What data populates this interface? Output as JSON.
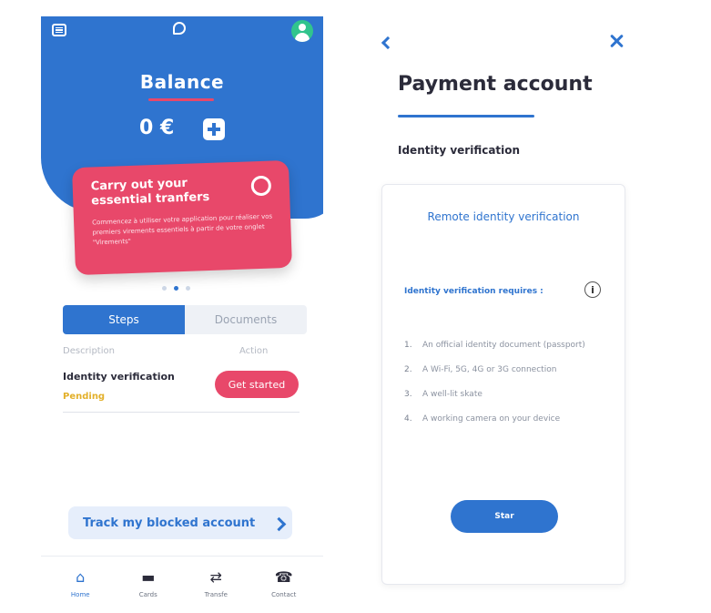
{
  "left_screen": {
    "balance": {
      "title": "Balance",
      "amount": "0 €"
    },
    "promo": {
      "title": "Carry out your essential tranfers",
      "body": "Commencez à utiliser votre application pour réaliser vos premiers virements essentiels à partir de votre onglet \"Virements\""
    },
    "carousel": {
      "active_index": 1,
      "count": 3
    },
    "tabs": [
      {
        "label": "Steps",
        "active": true
      },
      {
        "label": "Documents",
        "active": false
      }
    ],
    "table": {
      "headers": {
        "description": "Description",
        "action": "Action"
      },
      "rows": [
        {
          "name": "Identity verification",
          "status": "Pending",
          "action": "Get started"
        }
      ]
    },
    "track_button": {
      "label": "Track my blocked account"
    },
    "nav": [
      {
        "label": "Home",
        "icon": "home-icon",
        "active": true
      },
      {
        "label": "Cards",
        "icon": "card-icon",
        "active": false
      },
      {
        "label": "Transfe",
        "icon": "transfer-icon",
        "active": false
      },
      {
        "label": "Contact",
        "icon": "phone-icon",
        "active": false
      }
    ]
  },
  "right_screen": {
    "title": "Payment account",
    "section_label": "Identity verification",
    "card": {
      "title": "Remote identity verification",
      "requirements_label": "Identity verification requires :",
      "requirements": [
        "An official identity document (passport)",
        "A Wi-Fi, 5G, 4G or 3G connection",
        "A well-lit skate",
        "A working camera on your device"
      ],
      "start_label": "Star"
    }
  },
  "colors": {
    "primary_blue": "#2f74cf",
    "accent_pink": "#e8486a",
    "pending_yellow": "#e3b02a",
    "avatar_green": "#31c48d"
  }
}
